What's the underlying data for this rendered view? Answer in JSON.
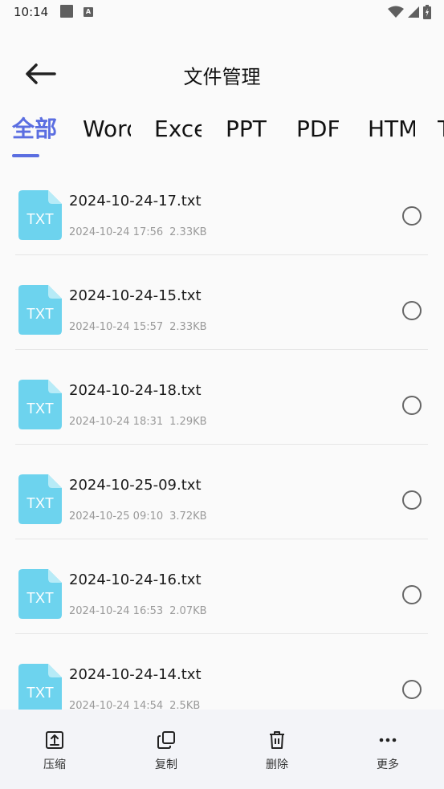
{
  "status_bar": {
    "time": "10:14",
    "a_badge": "A"
  },
  "header": {
    "title": "文件管理"
  },
  "tabs": [
    {
      "label": "全部",
      "active": true
    },
    {
      "label": "Word",
      "active": false
    },
    {
      "label": "Excel",
      "active": false
    },
    {
      "label": "PPT",
      "active": false
    },
    {
      "label": "PDF",
      "active": false
    },
    {
      "label": "HTML",
      "active": false
    },
    {
      "label": "T",
      "active": false
    }
  ],
  "files": [
    {
      "name": "2024-10-24-17.txt",
      "date": "2024-10-24 17:56",
      "size": "2.33KB",
      "icon_label": "TXT"
    },
    {
      "name": "2024-10-24-15.txt",
      "date": "2024-10-24 15:57",
      "size": "2.33KB",
      "icon_label": "TXT"
    },
    {
      "name": "2024-10-24-18.txt",
      "date": "2024-10-24 18:31",
      "size": "1.29KB",
      "icon_label": "TXT"
    },
    {
      "name": "2024-10-25-09.txt",
      "date": "2024-10-25 09:10",
      "size": "3.72KB",
      "icon_label": "TXT"
    },
    {
      "name": "2024-10-24-16.txt",
      "date": "2024-10-24 16:53",
      "size": "2.07KB",
      "icon_label": "TXT"
    },
    {
      "name": "2024-10-24-14.txt",
      "date": "2024-10-24 14:54",
      "size": "2.5KB",
      "icon_label": "TXT"
    }
  ],
  "bottom_bar": {
    "compress_label": "压缩",
    "copy_label": "复制",
    "delete_label": "删除",
    "more_label": "更多"
  },
  "colors": {
    "accent": "#5b6ee1",
    "txt_icon": "#6dd3ee",
    "bottom_bar_bg": "#f3f4f8"
  }
}
